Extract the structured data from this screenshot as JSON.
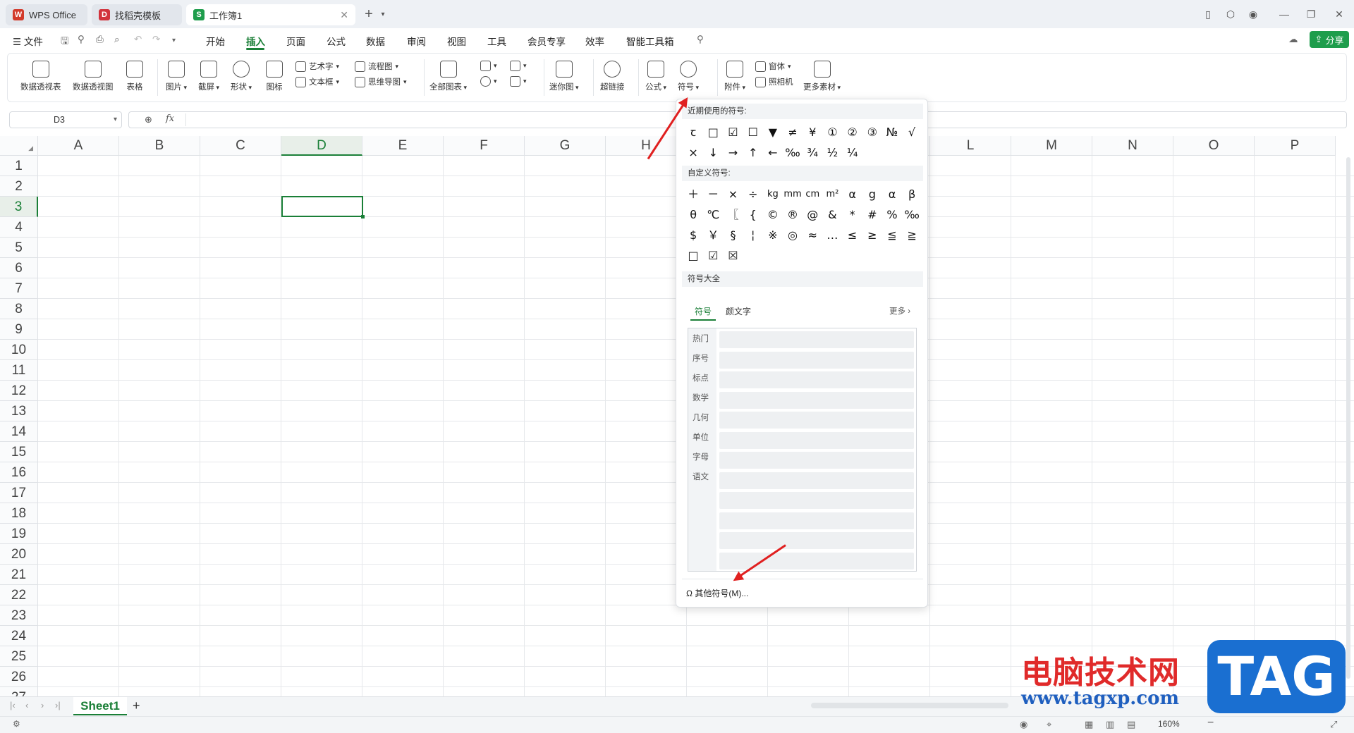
{
  "titlebar": {
    "tabs": [
      {
        "label": "WPS Office",
        "logo": "W"
      },
      {
        "label": "找稻壳模板",
        "logo": "D"
      },
      {
        "label": "工作簿1",
        "logo": "S"
      }
    ],
    "new_tab": "+"
  },
  "menubar": {
    "file": "文件",
    "items": [
      "开始",
      "插入",
      "页面",
      "公式",
      "数据",
      "审阅",
      "视图",
      "工具",
      "会员专享",
      "效率",
      "智能工具箱"
    ],
    "active": "插入",
    "share": "分享"
  },
  "ribbon": {
    "buttons": [
      "数据透视表",
      "数据透视图",
      "表格",
      "图片",
      "截屏",
      "形状",
      "图标",
      "全部图表",
      "迷你图",
      "超链接",
      "公式",
      "符号",
      "附件",
      "更多素材"
    ],
    "small": [
      "艺术字",
      "文本框",
      "流程图",
      "思维导图",
      "窗体",
      "照相机"
    ]
  },
  "formula": {
    "namebox": "D3",
    "fx": "fx"
  },
  "grid": {
    "columns": [
      "A",
      "B",
      "C",
      "D",
      "E",
      "F",
      "G",
      "H",
      "I",
      "J",
      "K",
      "L",
      "M",
      "N",
      "O",
      "P"
    ],
    "rows": [
      "1",
      "2",
      "3",
      "4",
      "5",
      "6",
      "7",
      "8",
      "9",
      "10",
      "11",
      "12",
      "13",
      "14",
      "15",
      "16",
      "17",
      "18",
      "19",
      "20",
      "21",
      "22",
      "23",
      "24",
      "25",
      "26",
      "27"
    ],
    "active_cell": "D3"
  },
  "sheets": {
    "names": [
      "Sheet1"
    ],
    "add": "+"
  },
  "status": {
    "zoom": "160%"
  },
  "symbol_panel": {
    "recent_title": "近期使用的符号:",
    "recent": [
      "ꞇ",
      "□",
      "☑",
      "☐",
      "▼",
      "≠",
      "¥",
      "①",
      "②",
      "③",
      "№",
      "√",
      "×",
      "↓",
      "→",
      "↑",
      "←",
      "‰",
      "¾",
      "½",
      "¼"
    ],
    "custom_title": "自定义符号:",
    "custom": [
      "＋",
      "－",
      "×",
      "÷",
      "kg",
      "mm",
      "cm",
      "m²",
      "α",
      "g",
      "α",
      "β",
      "θ",
      "℃",
      "〖",
      "{",
      "©",
      "®",
      "@",
      "&",
      "*",
      "#",
      "%",
      "‰",
      "$",
      "￥",
      "§",
      "¦",
      "※",
      "◎",
      "≈",
      "…",
      "≤",
      "≥",
      "≦",
      "≧",
      "□",
      "☑",
      "☒"
    ],
    "all_title": "符号大全",
    "tab_symbol": "符号",
    "tab_kaomoji": "颜文字",
    "more": "更多",
    "categories": [
      "热门",
      "序号",
      "标点",
      "数学",
      "几何",
      "单位",
      "字母",
      "语文"
    ],
    "other": "其他符号(M)..."
  },
  "watermark": {
    "line1": "电脑技术网",
    "line2": "www.tagxp.com",
    "badge": "TAG"
  },
  "colors": {
    "accent": "#1a7f37",
    "arrow": "#e02020",
    "share": "#1e9d4c"
  }
}
